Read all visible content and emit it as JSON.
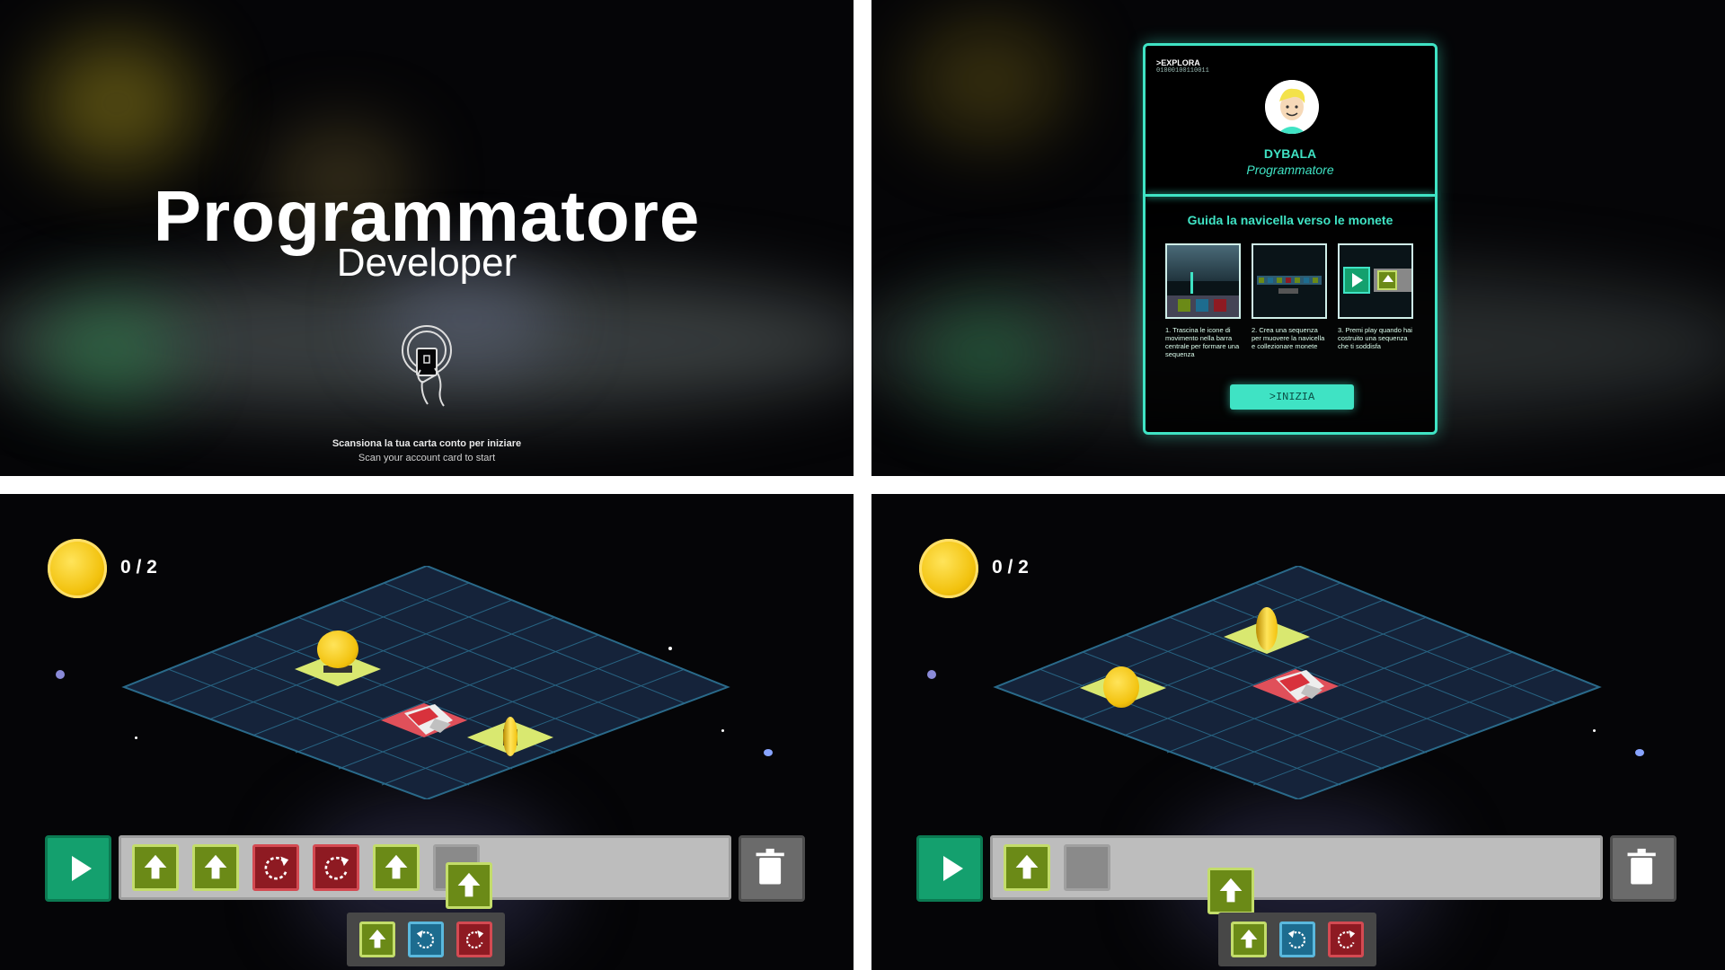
{
  "intro": {
    "title": "Programmatore",
    "subtitle": "Developer",
    "scan_prompt_it": "Scansiona la tua carta conto per iniziare",
    "scan_prompt_en": "Scan your account card to start",
    "icon": "card-scan-icon"
  },
  "profile_card": {
    "brand": ">EXPLORA",
    "code": "01000100110011",
    "user_name": "DYBALA",
    "user_role": "Programmatore",
    "guide_title": "Guida la navicella verso le monete",
    "steps": [
      {
        "text": "1. Trascina le icone di movimento nella barra centrale per formare una sequenza"
      },
      {
        "text": "2. Crea una sequenza per muovere la navicella e collezionare monete"
      },
      {
        "text": "3. Premi play quando hai costruito una sequenza che ti soddisfa"
      }
    ],
    "start_button": ">INIZIA",
    "accent": "#3fe3c4"
  },
  "game_level_1": {
    "score": "0 / 2",
    "sequence": [
      "up",
      "up",
      "rotate-cw",
      "rotate-cw",
      "up",
      "empty"
    ],
    "dragging": "up",
    "palette": [
      "up",
      "rotate-ccw",
      "rotate-cw"
    ]
  },
  "game_level_2": {
    "score": "0 / 2",
    "sequence": [
      "up",
      "empty"
    ],
    "dragging": "up",
    "palette": [
      "up",
      "rotate-ccw",
      "rotate-cw"
    ]
  },
  "colors": {
    "play": "#14a06e",
    "move_up": "#6b8a17",
    "rotate_cw": "#8e1a22",
    "rotate_ccw": "#1d6c8f",
    "coin": "#f2c20e",
    "grid": "#2a4a6a",
    "start_tile": "#e0505a",
    "coin_tile": "#d9e870"
  }
}
